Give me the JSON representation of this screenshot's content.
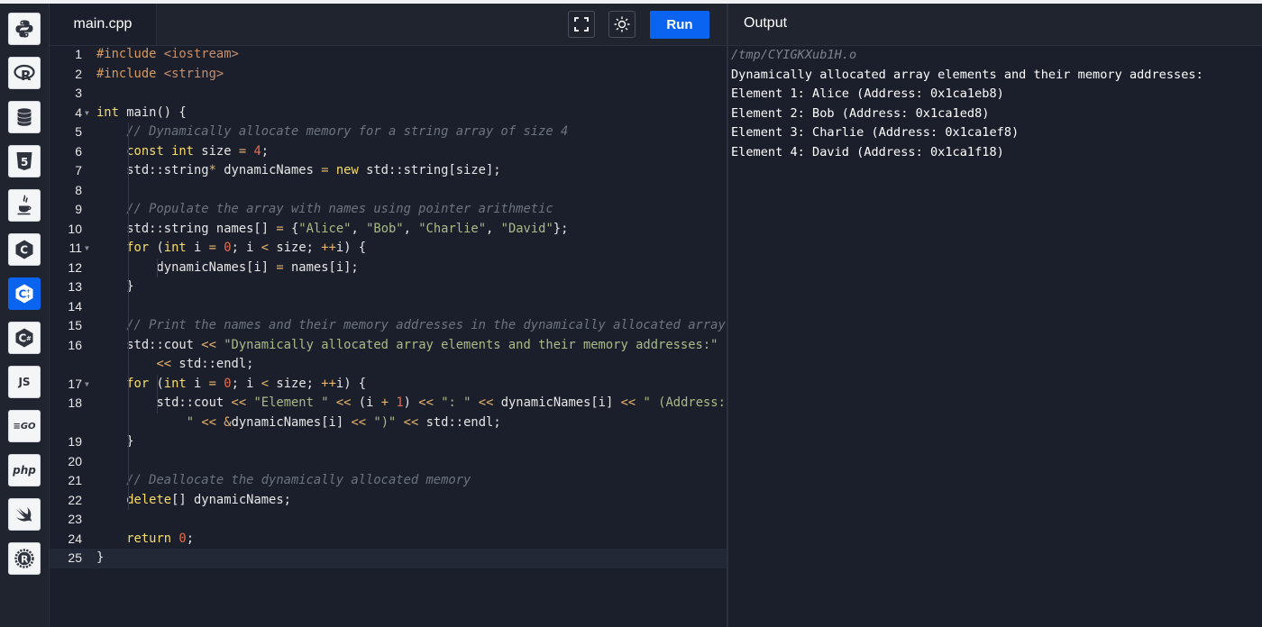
{
  "sidebar": {
    "languages": [
      {
        "name": "Python",
        "icon": "python-icon"
      },
      {
        "name": "R",
        "icon": "r-icon",
        "glyph": "R"
      },
      {
        "name": "SQL",
        "icon": "database-icon"
      },
      {
        "name": "HTML",
        "icon": "html5-icon",
        "glyph": "5"
      },
      {
        "name": "Java",
        "icon": "java-icon"
      },
      {
        "name": "C",
        "icon": "c-icon",
        "glyph": "C"
      },
      {
        "name": "C++",
        "icon": "cpp-icon",
        "glyph": "C",
        "active": true
      },
      {
        "name": "C#",
        "icon": "csharp-icon",
        "glyph": "C"
      },
      {
        "name": "JavaScript",
        "icon": "js-icon",
        "glyph": "JS"
      },
      {
        "name": "Go",
        "icon": "go-icon",
        "glyph": "GO"
      },
      {
        "name": "PHP",
        "icon": "php-icon",
        "glyph": "php"
      },
      {
        "name": "Swift",
        "icon": "swift-icon"
      },
      {
        "name": "Rust",
        "icon": "rust-icon",
        "glyph": "R"
      }
    ]
  },
  "editor": {
    "file_tab": "main.cpp",
    "fullscreen_icon": "fullscreen-icon",
    "theme_icon": "sun-icon",
    "run_label": "Run",
    "lines": [
      {
        "num": "1",
        "tokens": [
          [
            "pp",
            "#include "
          ],
          [
            "str",
            "<iostream>"
          ]
        ]
      },
      {
        "num": "2",
        "tokens": [
          [
            "pp",
            "#include "
          ],
          [
            "str",
            "<string>"
          ]
        ]
      },
      {
        "num": "3",
        "tokens": []
      },
      {
        "num": "4",
        "fold": true,
        "tokens": [
          [
            "kw",
            "int"
          ],
          [
            "plain",
            " main() {"
          ]
        ]
      },
      {
        "num": "5",
        "tokens": [
          [
            "plain",
            "    "
          ],
          [
            "cmt",
            "// Dynamically allocate memory for a string array of size 4"
          ]
        ]
      },
      {
        "num": "6",
        "tokens": [
          [
            "plain",
            "    "
          ],
          [
            "kw",
            "const int"
          ],
          [
            "plain",
            " size "
          ],
          [
            "op",
            "="
          ],
          [
            "plain",
            " "
          ],
          [
            "num",
            "4"
          ],
          [
            "plain",
            ";"
          ]
        ]
      },
      {
        "num": "7",
        "tokens": [
          [
            "plain",
            "    std::string"
          ],
          [
            "op",
            "*"
          ],
          [
            "plain",
            " dynamicNames "
          ],
          [
            "op",
            "="
          ],
          [
            "plain",
            " "
          ],
          [
            "kw",
            "new"
          ],
          [
            "plain",
            " std::string[size];"
          ]
        ]
      },
      {
        "num": "8",
        "tokens": []
      },
      {
        "num": "9",
        "tokens": [
          [
            "plain",
            "    "
          ],
          [
            "cmt",
            "// Populate the array with names using pointer arithmetic"
          ]
        ]
      },
      {
        "num": "10",
        "tokens": [
          [
            "plain",
            "    std::string names[] "
          ],
          [
            "op",
            "="
          ],
          [
            "plain",
            " {"
          ],
          [
            "lit",
            "\"Alice\""
          ],
          [
            "plain",
            ", "
          ],
          [
            "lit",
            "\"Bob\""
          ],
          [
            "plain",
            ", "
          ],
          [
            "lit",
            "\"Charlie\""
          ],
          [
            "plain",
            ", "
          ],
          [
            "lit",
            "\"David\""
          ],
          [
            "plain",
            "};"
          ]
        ]
      },
      {
        "num": "11",
        "fold": true,
        "tokens": [
          [
            "plain",
            "    "
          ],
          [
            "kw",
            "for"
          ],
          [
            "plain",
            " ("
          ],
          [
            "kw",
            "int"
          ],
          [
            "plain",
            " i "
          ],
          [
            "op",
            "="
          ],
          [
            "plain",
            " "
          ],
          [
            "num",
            "0"
          ],
          [
            "plain",
            "; i "
          ],
          [
            "op",
            "<"
          ],
          [
            "plain",
            " size; "
          ],
          [
            "op",
            "++"
          ],
          [
            "plain",
            "i) {"
          ]
        ]
      },
      {
        "num": "12",
        "tokens": [
          [
            "plain",
            "        dynamicNames[i] "
          ],
          [
            "op",
            "="
          ],
          [
            "plain",
            " names[i];"
          ]
        ]
      },
      {
        "num": "13",
        "tokens": [
          [
            "plain",
            "    }"
          ]
        ]
      },
      {
        "num": "14",
        "tokens": []
      },
      {
        "num": "15",
        "tokens": [
          [
            "plain",
            "    "
          ],
          [
            "cmt",
            "// Print the names and their memory addresses in the dynamically allocated array"
          ]
        ]
      },
      {
        "num": "16",
        "tokens": [
          [
            "plain",
            "    std::cout "
          ],
          [
            "op",
            "<<"
          ],
          [
            "plain",
            " "
          ],
          [
            "lit",
            "\"Dynamically allocated array elements and their memory addresses:\""
          ]
        ],
        "wrap": [
          [
            "plain",
            "        "
          ],
          [
            "op",
            "<<"
          ],
          [
            "plain",
            " std::endl;"
          ]
        ]
      },
      {
        "num": "17",
        "fold": true,
        "tokens": [
          [
            "plain",
            "    "
          ],
          [
            "kw",
            "for"
          ],
          [
            "plain",
            " ("
          ],
          [
            "kw",
            "int"
          ],
          [
            "plain",
            " i "
          ],
          [
            "op",
            "="
          ],
          [
            "plain",
            " "
          ],
          [
            "num",
            "0"
          ],
          [
            "plain",
            "; i "
          ],
          [
            "op",
            "<"
          ],
          [
            "plain",
            " size; "
          ],
          [
            "op",
            "++"
          ],
          [
            "plain",
            "i) {"
          ]
        ]
      },
      {
        "num": "18",
        "tokens": [
          [
            "plain",
            "        std::cout "
          ],
          [
            "op",
            "<<"
          ],
          [
            "plain",
            " "
          ],
          [
            "lit",
            "\"Element \""
          ],
          [
            "plain",
            " "
          ],
          [
            "op",
            "<<"
          ],
          [
            "plain",
            " (i "
          ],
          [
            "op",
            "+"
          ],
          [
            "plain",
            " "
          ],
          [
            "num",
            "1"
          ],
          [
            "plain",
            ") "
          ],
          [
            "op",
            "<<"
          ],
          [
            "plain",
            " "
          ],
          [
            "lit",
            "\": \""
          ],
          [
            "plain",
            " "
          ],
          [
            "op",
            "<<"
          ],
          [
            "plain",
            " dynamicNames[i] "
          ],
          [
            "op",
            "<<"
          ],
          [
            "plain",
            " "
          ],
          [
            "lit",
            "\" (Address:"
          ]
        ],
        "wrap": [
          [
            "plain",
            "            "
          ],
          [
            "lit",
            "\""
          ],
          [
            "plain",
            " "
          ],
          [
            "op",
            "<<"
          ],
          [
            "plain",
            " "
          ],
          [
            "op",
            "&"
          ],
          [
            "plain",
            "dynamicNames[i] "
          ],
          [
            "op",
            "<<"
          ],
          [
            "plain",
            " "
          ],
          [
            "lit",
            "\")\""
          ],
          [
            "plain",
            " "
          ],
          [
            "op",
            "<<"
          ],
          [
            "plain",
            " std::endl;"
          ]
        ]
      },
      {
        "num": "19",
        "tokens": [
          [
            "plain",
            "    }"
          ]
        ]
      },
      {
        "num": "20",
        "tokens": []
      },
      {
        "num": "21",
        "tokens": [
          [
            "plain",
            "    "
          ],
          [
            "cmt",
            "// Deallocate the dynamically allocated memory"
          ]
        ]
      },
      {
        "num": "22",
        "tokens": [
          [
            "plain",
            "    "
          ],
          [
            "kw",
            "delete"
          ],
          [
            "plain",
            "[] dynamicNames;"
          ]
        ]
      },
      {
        "num": "23",
        "tokens": []
      },
      {
        "num": "24",
        "tokens": [
          [
            "plain",
            "    "
          ],
          [
            "kw",
            "return"
          ],
          [
            "plain",
            " "
          ],
          [
            "num",
            "0"
          ],
          [
            "plain",
            ";"
          ]
        ]
      },
      {
        "num": "25",
        "current": true,
        "tokens": [
          [
            "plain",
            "}"
          ]
        ]
      }
    ]
  },
  "output": {
    "title": "Output",
    "path": "/tmp/CYIGKXub1H.o",
    "lines": [
      "Dynamically allocated array elements and their memory addresses:",
      "Element 1: Alice (Address: 0x1ca1eb8)",
      "Element 2: Bob (Address: 0x1ca1ed8)",
      "Element 3: Charlie (Address: 0x1ca1ef8)",
      "Element 4: David (Address: 0x1ca1f18)"
    ]
  }
}
